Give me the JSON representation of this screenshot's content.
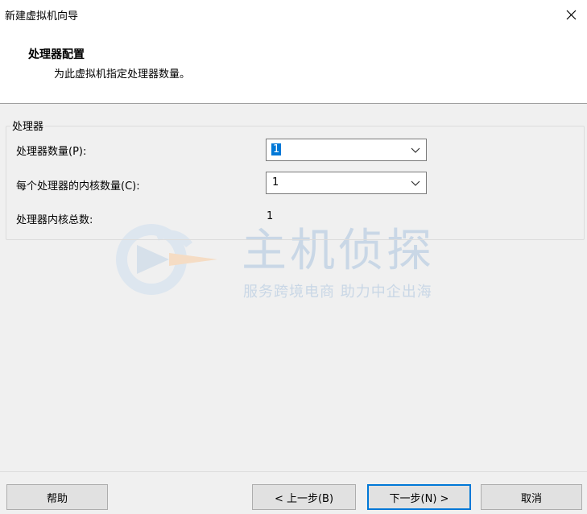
{
  "window": {
    "title": "新建虚拟机向导"
  },
  "header": {
    "title": "处理器配置",
    "subtitle": "为此虚拟机指定处理器数量。"
  },
  "group": {
    "legend": "处理器",
    "processor_count": {
      "label": "处理器数量(P):",
      "value": "1"
    },
    "cores_per_processor": {
      "label": "每个处理器的内核数量(C):",
      "value": "1"
    },
    "total_cores": {
      "label": "处理器内核总数:",
      "value": "1"
    }
  },
  "watermark": {
    "brand": "主机侦探",
    "slogan": "服务跨境电商 助力中企出海"
  },
  "footer": {
    "help": "帮助",
    "back": "< 上一步(B)",
    "next": "下一步(N) >",
    "cancel": "取消"
  },
  "colors": {
    "accent": "#0078d7",
    "body": "#f0f0f0",
    "watermark": "#c9d7e6"
  }
}
